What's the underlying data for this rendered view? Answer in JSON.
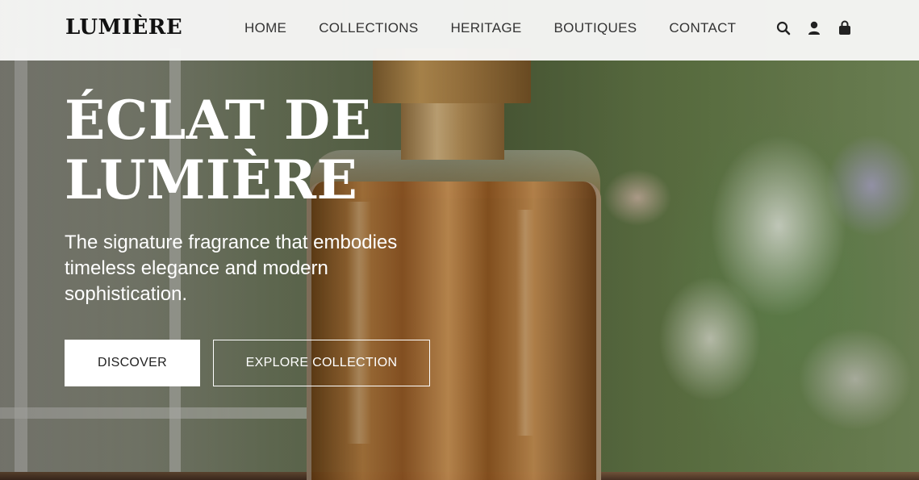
{
  "header": {
    "logo": "LUMIÈRE",
    "nav": [
      {
        "label": "HOME"
      },
      {
        "label": "COLLECTIONS"
      },
      {
        "label": "HERITAGE"
      },
      {
        "label": "BOUTIQUES"
      },
      {
        "label": "CONTACT"
      }
    ],
    "icons": [
      "search-icon",
      "user-icon",
      "shopping-bag-icon"
    ]
  },
  "hero": {
    "title_line1": "ÉCLAT DE",
    "title_line2": "LUMIÈRE",
    "subtitle": "The signature fragrance that embodies timeless elegance and modern sophistication.",
    "primary_button": "DISCOVER",
    "secondary_button": "EXPLORE COLLECTION"
  },
  "colors": {
    "header_bg": "#f6f6f5",
    "text_dark": "#111111",
    "hero_text": "#ffffff",
    "amber": "#c98a45",
    "gold_cap": "#d2a45d"
  }
}
